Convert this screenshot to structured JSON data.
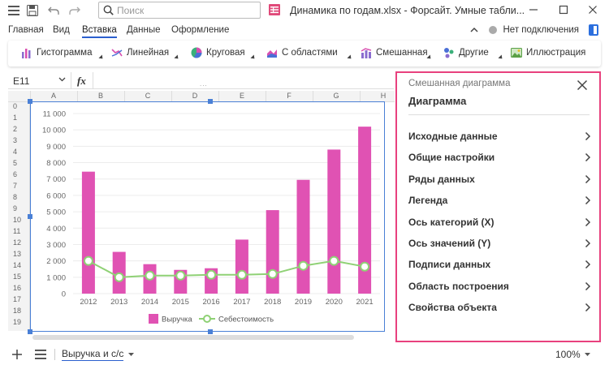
{
  "search": {
    "placeholder": "Поиск"
  },
  "window": {
    "title": "Динамика по годам.xlsx - Форсайт. Умные табли..."
  },
  "menu": {
    "items": [
      "Главная",
      "Вид",
      "Вставка",
      "Данные",
      "Оформление"
    ],
    "active": "Вставка"
  },
  "connection": {
    "status": "Нет подключения"
  },
  "ribbon": {
    "items": [
      "Гистограмма",
      "Линейная",
      "Круговая",
      "С областями",
      "Смешанная",
      "Другие",
      "Иллюстрация"
    ]
  },
  "formula": {
    "cell_ref": "E11",
    "fx": "fx",
    "value": ""
  },
  "columns": [
    "A",
    "B",
    "C",
    "D",
    "E",
    "F",
    "G",
    "H"
  ],
  "rows": [
    "0",
    "1",
    "2",
    "3",
    "4",
    "5",
    "6",
    "7",
    "8",
    "9",
    "10",
    "11",
    "12",
    "13",
    "14",
    "15",
    "16",
    "17",
    "18",
    "19"
  ],
  "chart_data": {
    "type": "bar",
    "categories": [
      "2012",
      "2013",
      "2014",
      "2015",
      "2016",
      "2017",
      "2018",
      "2019",
      "2020",
      "2021"
    ],
    "series": [
      {
        "name": "Выручка",
        "type": "bar",
        "color": "#e052b3",
        "values": [
          7450,
          2550,
          1800,
          1450,
          1550,
          3300,
          5100,
          6950,
          8800,
          10200
        ]
      },
      {
        "name": "Себестоимость",
        "type": "line",
        "color": "#8fd175",
        "values": [
          2000,
          1000,
          1100,
          1100,
          1150,
          1150,
          1200,
          1700,
          2000,
          1650
        ]
      }
    ],
    "y_ticks": [
      "0",
      "1 000",
      "2 000",
      "3 000",
      "4 000",
      "5 000",
      "6 000",
      "7 000",
      "8 000",
      "9 000",
      "10 000",
      "11 000"
    ],
    "ylim": [
      0,
      11000
    ],
    "grid": true,
    "legend_position": "bottom"
  },
  "panel": {
    "subtitle": "Смешанная диаграмма",
    "title": "Диаграмма",
    "items": [
      "Исходные данные",
      "Общие настройки",
      "Ряды данных",
      "Легенда",
      "Ось категорий (X)",
      "Ось значений (Y)",
      "Подписи данных",
      "Область построения",
      "Свойства объекта"
    ]
  },
  "bottom": {
    "sheet_tab": "Выручка и с/с",
    "zoom": "100%"
  },
  "colors": {
    "accent": "#2b5fce",
    "panel_border": "#e8417e",
    "bar": "#e052b3",
    "line": "#8fd175"
  }
}
